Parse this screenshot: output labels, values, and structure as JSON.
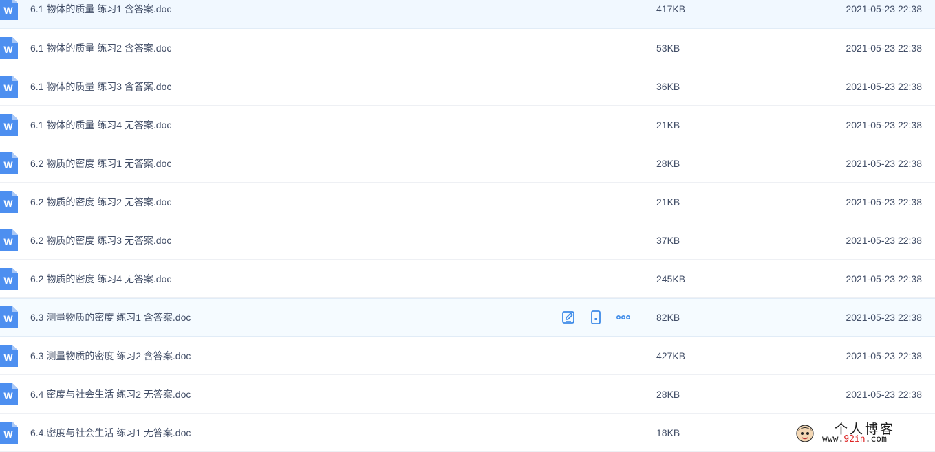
{
  "files": [
    {
      "name": "6.1 物体的质量 练习1 含答案.doc",
      "size": "417KB",
      "modified": "2021-05-23 22:38",
      "state": "selected"
    },
    {
      "name": "6.1 物体的质量 练习2 含答案.doc",
      "size": "53KB",
      "modified": "2021-05-23 22:38",
      "state": ""
    },
    {
      "name": "6.1 物体的质量 练习3 含答案.doc",
      "size": "36KB",
      "modified": "2021-05-23 22:38",
      "state": ""
    },
    {
      "name": "6.1 物体的质量 练习4 无答案.doc",
      "size": "21KB",
      "modified": "2021-05-23 22:38",
      "state": ""
    },
    {
      "name": "6.2 物质的密度 练习1 无答案.doc",
      "size": "28KB",
      "modified": "2021-05-23 22:38",
      "state": ""
    },
    {
      "name": "6.2 物质的密度 练习2 无答案.doc",
      "size": "21KB",
      "modified": "2021-05-23 22:38",
      "state": ""
    },
    {
      "name": "6.2 物质的密度 练习3 无答案.doc",
      "size": "37KB",
      "modified": "2021-05-23 22:38",
      "state": ""
    },
    {
      "name": "6.2 物质的密度 练习4 无答案.doc",
      "size": "245KB",
      "modified": "2021-05-23 22:38",
      "state": ""
    },
    {
      "name": "6.3 测量物质的密度 练习1 含答案.doc",
      "size": "82KB",
      "modified": "2021-05-23 22:38",
      "state": "hover"
    },
    {
      "name": "6.3 测量物质的密度 练习2 含答案.doc",
      "size": "427KB",
      "modified": "2021-05-23 22:38",
      "state": ""
    },
    {
      "name": "6.4 密度与社会生活 练习2 无答案.doc",
      "size": "28KB",
      "modified": "2021-05-23 22:38",
      "state": ""
    },
    {
      "name": "6.4.密度与社会生活 练习1 无答案.doc",
      "size": "18KB",
      "modified": "",
      "state": ""
    }
  ],
  "row_actions": [
    "edit-icon",
    "phone-icon",
    "more-icon"
  ],
  "file_icon": {
    "name": "word-doc-icon",
    "letter": "W",
    "color": "#4d8ff0"
  },
  "watermark": {
    "title": "个人博客",
    "url_prefix": "www.",
    "url_highlight": "92in",
    "url_suffix": ".com"
  }
}
